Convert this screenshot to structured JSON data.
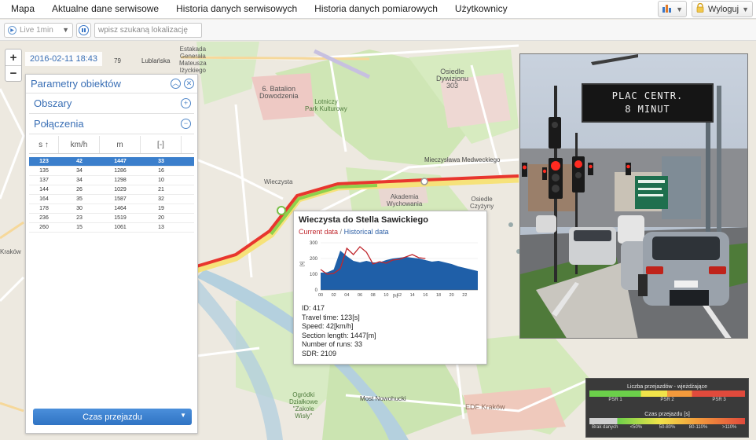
{
  "menu": [
    "Mapa",
    "Aktualne dane serwisowe",
    "Historia danych serwisowych",
    "Historia danych pomiarowych",
    "Użytkownicy"
  ],
  "header_buttons": {
    "logout": "Wyloguj"
  },
  "toolbar": {
    "live_value": "Live 1min",
    "search_placeholder": "wpisz szukaną lokalizację"
  },
  "map": {
    "timestamp": "2016-02-11 18:43",
    "labels": {
      "road_79": "79",
      "lublanska": "Lublańska",
      "estakada": "Estakada\nGenerała\nMateusza\nIżyckiego",
      "batalion": "6. Batalion\nDowodzenia",
      "park": "Lotniczy\nPark Kulturowy",
      "osiedle_dywizjonu": "Osiedle\nDywizjonu\n303",
      "medweckiego": "Mieczysława Medweckiego",
      "wieczysta": "Wieczysta",
      "akademia": "Akademia\nWychowania",
      "osiedle_czyzyny": "Osiedle\nCzyżyny",
      "ogrodki": "Ogródki\nDziałkowe\n\"Zakole\nWisły\"",
      "most": "Most Nowohucki",
      "edf": "EDF Kraków",
      "krakow": "Kraków"
    }
  },
  "zoom": {
    "in": "+",
    "out": "−"
  },
  "panel": {
    "title": "Parametry obiektów",
    "sections": [
      "Obszary",
      "Połączenia"
    ],
    "columns": [
      "s ↑",
      "km/h",
      "m",
      "[-]"
    ],
    "rows": [
      [
        "123",
        "42",
        "1447",
        "33"
      ],
      [
        "135",
        "34",
        "1286",
        "16"
      ],
      [
        "137",
        "34",
        "1298",
        "10"
      ],
      [
        "144",
        "26",
        "1029",
        "21"
      ],
      [
        "164",
        "35",
        "1587",
        "32"
      ],
      [
        "178",
        "30",
        "1464",
        "19"
      ],
      [
        "236",
        "23",
        "1519",
        "20"
      ],
      [
        "260",
        "15",
        "1061",
        "13"
      ]
    ],
    "selected_row": 0,
    "bottom_select": "Czas przejazdu"
  },
  "popup": {
    "title": "Wieczysta do Stella Sawickiego",
    "legend_current": "Current data",
    "legend_separator": "/",
    "legend_historical": "Historical data",
    "info": [
      "ID: 417",
      "Travel time: 123[s]",
      "Speed: 42[km/h]",
      "Section length: 1447[m]",
      "Number of runs: 33",
      "SDR: 2109"
    ]
  },
  "chart_data": {
    "type": "area",
    "ylabel": "[s]",
    "xlabel": "[h]",
    "ylim": [
      0,
      300
    ],
    "yticks": [
      "300",
      "200",
      "100",
      "0"
    ],
    "x": [
      0,
      1,
      2,
      3,
      4,
      5,
      6,
      7,
      8,
      9,
      10,
      11,
      12,
      13,
      14,
      15,
      16,
      17,
      18,
      19,
      20,
      21,
      22,
      23,
      24
    ],
    "xticks": [
      "00",
      "02",
      "04",
      "06",
      "08",
      "10",
      "12",
      "14",
      "16",
      "18",
      "20",
      "22"
    ],
    "series": [
      {
        "name": "Historical data",
        "color": "#1f5fa8",
        "values": [
          110,
          112,
          130,
          250,
          215,
          185,
          175,
          185,
          175,
          175,
          190,
          200,
          205,
          210,
          205,
          200,
          190,
          180,
          185,
          175,
          165,
          150,
          140,
          130,
          120
        ]
      },
      {
        "name": "Current data",
        "color": "#c0272d",
        "values": [
          null,
          null,
          null,
          null,
          null,
          null,
          null,
          null,
          null,
          null,
          null,
          null,
          null,
          null,
          null,
          null,
          null,
          null,
          null,
          null,
          null,
          null,
          null,
          null,
          null
        ],
        "current": [
          130,
          100,
          105,
          135,
          265,
          225,
          275,
          240,
          165,
          180,
          170,
          190,
          195,
          210,
          225,
          205,
          200
        ]
      }
    ]
  },
  "camera": {
    "sign_line1": "PLAC CENTR.",
    "sign_line2": "8 MINUT"
  },
  "legend": {
    "runs_title": "Liczba przejazdów - wjeżdżające",
    "runs_labels": [
      "PSR 1",
      "PSR 2",
      "PSR 3"
    ],
    "time_title": "Czas przejazdu [s]",
    "time_labels": [
      "Brak danych",
      "<50%",
      "50-80%",
      "80-110%",
      ">110%"
    ],
    "colors": {
      "green": "#6bcf4a",
      "yellow": "#f0e34a",
      "orange": "#f39a3c",
      "red": "#e04a3c",
      "gray": "#cfcfcf"
    }
  }
}
